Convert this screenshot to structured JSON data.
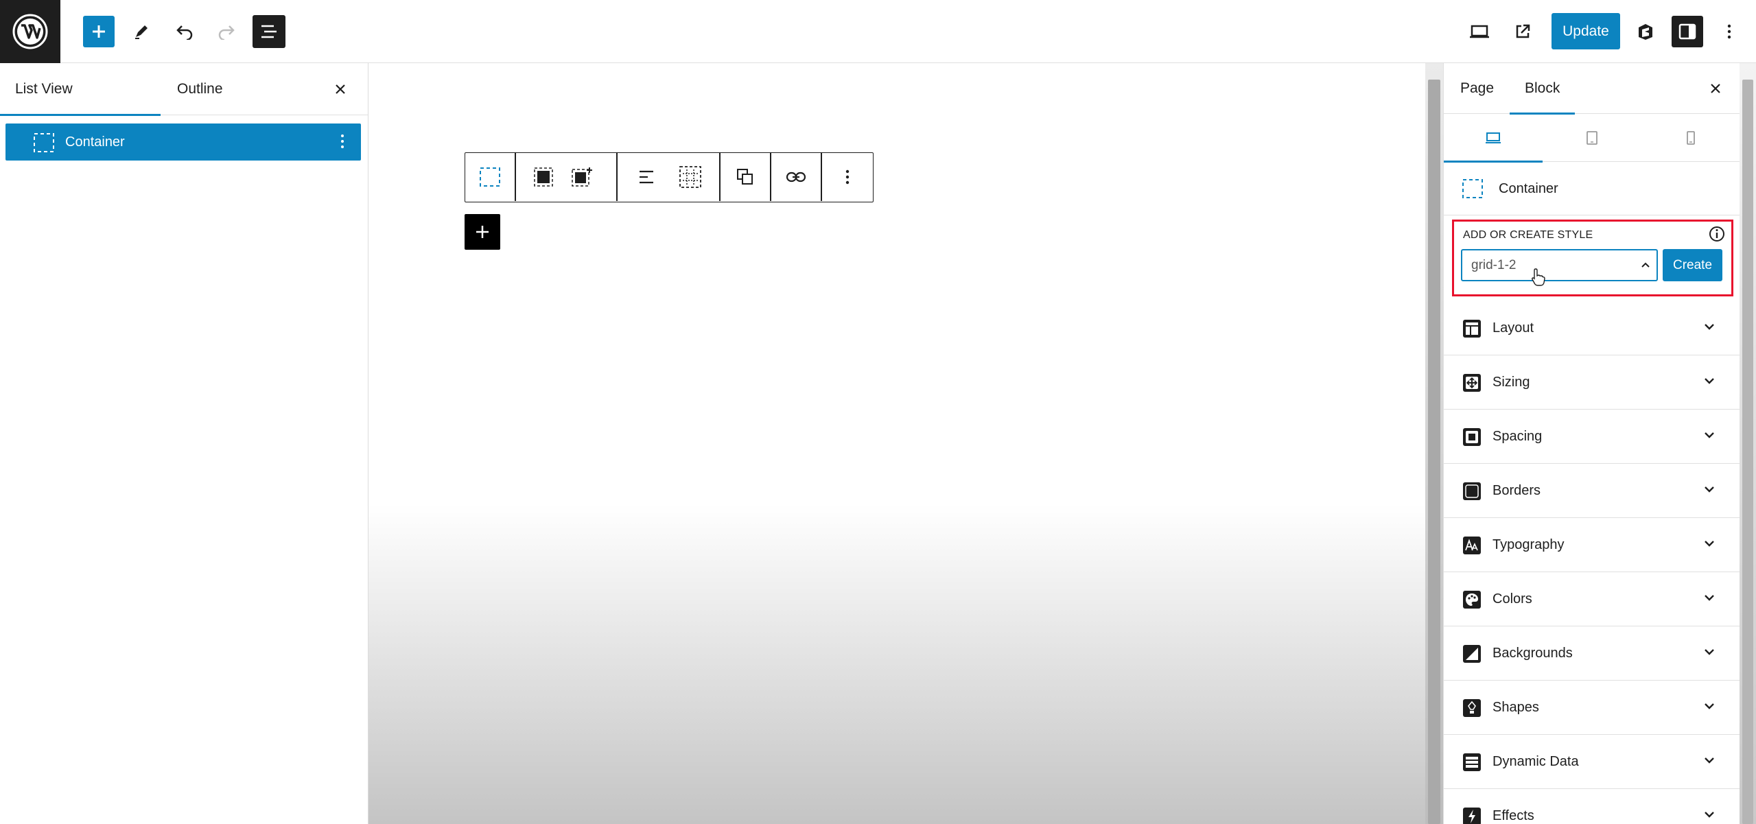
{
  "topbar": {
    "update_label": "Update",
    "icons": [
      "wordpress-logo",
      "plus-icon",
      "pencil-icon",
      "undo-icon",
      "redo-icon",
      "document-overview-icon",
      "desktop-preview-icon",
      "external-link-icon",
      "plugin-logo-icon",
      "sidebar-toggle-icon",
      "more-vertical-icon"
    ]
  },
  "left_panel": {
    "tabs": [
      {
        "label": "List View",
        "active": true
      },
      {
        "label": "Outline",
        "active": false
      }
    ],
    "items": [
      {
        "label": "Container",
        "selected": true
      }
    ]
  },
  "right_panel": {
    "tabs": [
      {
        "label": "Page",
        "active": false
      },
      {
        "label": "Block",
        "active": true
      }
    ],
    "devices": [
      "desktop",
      "tablet",
      "mobile"
    ],
    "block_name": "Container",
    "style": {
      "label": "ADD OR CREATE STYLE",
      "value": "grid-1-2",
      "create_label": "Create"
    },
    "panels": [
      {
        "label": "Layout"
      },
      {
        "label": "Sizing"
      },
      {
        "label": "Spacing"
      },
      {
        "label": "Borders"
      },
      {
        "label": "Typography"
      },
      {
        "label": "Colors"
      },
      {
        "label": "Backgrounds"
      },
      {
        "label": "Shapes"
      },
      {
        "label": "Dynamic Data"
      },
      {
        "label": "Effects"
      }
    ]
  },
  "colors": {
    "accent": "#0c84c0",
    "highlight_box": "#e8112d",
    "dark": "#1e1e1e"
  }
}
